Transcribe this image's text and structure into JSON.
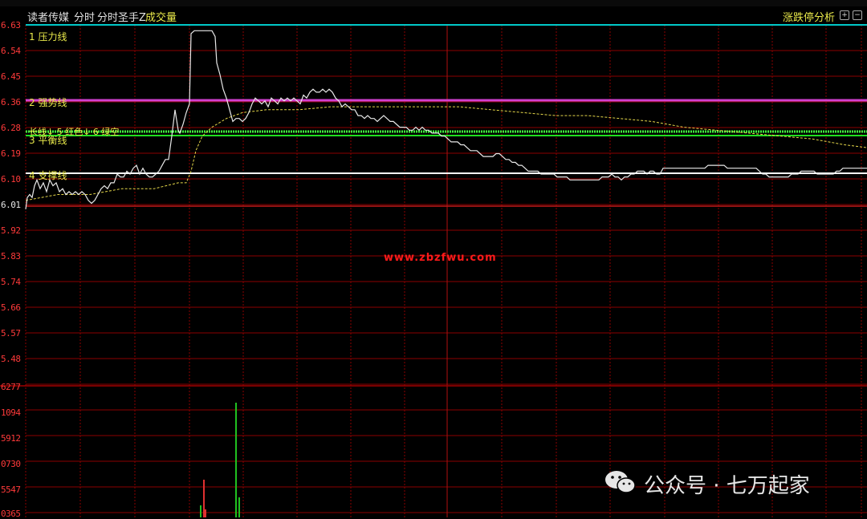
{
  "header": {
    "stock_name": "读者传媒",
    "tab_minute": "分时",
    "indicator_name": "分时圣手Z",
    "volume_label": "成交量",
    "right_panel_label": "涨跌停分析"
  },
  "price_axis": {
    "ticks": [
      "6.63",
      "6.54",
      "6.45",
      "6.36",
      "6.28",
      "6.19",
      "6.10",
      "6.01",
      "5.92",
      "5.83",
      "5.74",
      "5.66",
      "5.57",
      "5.48"
    ]
  },
  "volume_axis": {
    "ticks": [
      "6277",
      "1094",
      "5912",
      "0730",
      "5547",
      "0365"
    ]
  },
  "levels": {
    "pressure": "1 压力线",
    "strong": "2 强势线",
    "balance": "3 平衡线",
    "support": "4 支撑线",
    "signal": "长线↓ 5 红色↓ 6 绿空"
  },
  "watermark": "www.zbzfwu.com",
  "wechat": "公众号 · 七万起家",
  "colors": {
    "background": "#000000",
    "grid": "#8b0000",
    "pressure_line": "#00c8c8",
    "strong_line": "#d040d0",
    "balance_line": "#20e020",
    "support_line": "#ffffff",
    "price_line": "#e8e8e8",
    "avg_line": "#e6d84a",
    "label_yellow": "#e8e84a"
  },
  "chart_data": {
    "type": "line",
    "title": "读者传媒 分时",
    "ylim": [
      5.44,
      6.63
    ],
    "levels": {
      "pressure": 6.63,
      "strong": 6.37,
      "balance": 6.16,
      "support": 6.11
    },
    "price": [
      [
        0,
        6.0
      ],
      [
        2,
        6.04
      ],
      [
        5,
        6.05
      ],
      [
        8,
        6.04
      ],
      [
        11,
        6.08
      ],
      [
        14,
        6.1
      ],
      [
        18,
        6.07
      ],
      [
        22,
        6.09
      ],
      [
        26,
        6.06
      ],
      [
        30,
        6.1
      ],
      [
        34,
        6.08
      ],
      [
        38,
        6.09
      ],
      [
        42,
        6.06
      ],
      [
        46,
        6.07
      ],
      [
        50,
        6.05
      ],
      [
        54,
        6.06
      ],
      [
        58,
        6.05
      ],
      [
        62,
        6.06
      ],
      [
        66,
        6.05
      ],
      [
        70,
        6.06
      ],
      [
        74,
        6.05
      ],
      [
        78,
        6.03
      ],
      [
        82,
        6.02
      ],
      [
        86,
        6.03
      ],
      [
        90,
        6.05
      ],
      [
        94,
        6.07
      ],
      [
        98,
        6.08
      ],
      [
        102,
        6.07
      ],
      [
        106,
        6.09
      ],
      [
        110,
        6.09
      ],
      [
        114,
        6.12
      ],
      [
        118,
        6.11
      ],
      [
        122,
        6.11
      ],
      [
        126,
        6.13
      ],
      [
        130,
        6.12
      ],
      [
        134,
        6.14
      ],
      [
        138,
        6.15
      ],
      [
        142,
        6.12
      ],
      [
        146,
        6.14
      ],
      [
        150,
        6.12
      ],
      [
        154,
        6.11
      ],
      [
        158,
        6.11
      ],
      [
        162,
        6.12
      ],
      [
        166,
        6.13
      ],
      [
        170,
        6.15
      ],
      [
        174,
        6.17
      ],
      [
        178,
        6.17
      ],
      [
        182,
        6.25
      ],
      [
        186,
        6.34
      ],
      [
        190,
        6.27
      ],
      [
        192,
        6.26
      ],
      [
        196,
        6.29
      ],
      [
        200,
        6.33
      ],
      [
        204,
        6.36
      ],
      [
        206,
        6.6
      ],
      [
        210,
        6.61
      ],
      [
        216,
        6.61
      ],
      [
        222,
        6.61
      ],
      [
        228,
        6.61
      ],
      [
        232,
        6.61
      ],
      [
        236,
        6.59
      ],
      [
        238,
        6.5
      ],
      [
        242,
        6.46
      ],
      [
        246,
        6.41
      ],
      [
        250,
        6.38
      ],
      [
        254,
        6.34
      ],
      [
        258,
        6.3
      ],
      [
        262,
        6.31
      ],
      [
        266,
        6.31
      ],
      [
        270,
        6.3
      ],
      [
        274,
        6.31
      ],
      [
        278,
        6.33
      ],
      [
        282,
        6.36
      ],
      [
        286,
        6.38
      ],
      [
        290,
        6.37
      ],
      [
        294,
        6.36
      ],
      [
        298,
        6.37
      ],
      [
        302,
        6.35
      ],
      [
        306,
        6.38
      ],
      [
        310,
        6.37
      ],
      [
        314,
        6.36
      ],
      [
        318,
        6.38
      ],
      [
        322,
        6.37
      ],
      [
        326,
        6.38
      ],
      [
        330,
        6.37
      ],
      [
        334,
        6.38
      ],
      [
        338,
        6.37
      ],
      [
        342,
        6.36
      ],
      [
        346,
        6.39
      ],
      [
        350,
        6.38
      ],
      [
        354,
        6.4
      ],
      [
        358,
        6.41
      ],
      [
        362,
        6.4
      ],
      [
        366,
        6.4
      ],
      [
        370,
        6.41
      ],
      [
        374,
        6.4
      ],
      [
        378,
        6.41
      ],
      [
        382,
        6.4
      ],
      [
        386,
        6.38
      ],
      [
        390,
        6.37
      ],
      [
        394,
        6.35
      ],
      [
        398,
        6.36
      ],
      [
        402,
        6.35
      ],
      [
        406,
        6.34
      ],
      [
        410,
        6.34
      ],
      [
        414,
        6.32
      ],
      [
        418,
        6.32
      ],
      [
        422,
        6.31
      ],
      [
        426,
        6.32
      ],
      [
        430,
        6.31
      ],
      [
        434,
        6.31
      ],
      [
        438,
        6.3
      ],
      [
        442,
        6.31
      ],
      [
        446,
        6.32
      ],
      [
        450,
        6.31
      ],
      [
        454,
        6.3
      ],
      [
        458,
        6.3
      ],
      [
        462,
        6.29
      ],
      [
        466,
        6.28
      ],
      [
        470,
        6.28
      ],
      [
        474,
        6.28
      ],
      [
        478,
        6.27
      ],
      [
        482,
        6.27
      ],
      [
        486,
        6.28
      ],
      [
        490,
        6.27
      ],
      [
        494,
        6.28
      ],
      [
        498,
        6.27
      ],
      [
        502,
        6.27
      ],
      [
        506,
        6.26
      ],
      [
        510,
        6.26
      ],
      [
        514,
        6.26
      ],
      [
        518,
        6.25
      ],
      [
        522,
        6.25
      ],
      [
        526,
        6.24
      ],
      [
        530,
        6.23
      ],
      [
        534,
        6.23
      ],
      [
        538,
        6.23
      ],
      [
        542,
        6.22
      ],
      [
        546,
        6.22
      ],
      [
        550,
        6.21
      ],
      [
        554,
        6.2
      ],
      [
        558,
        6.2
      ],
      [
        562,
        6.2
      ],
      [
        566,
        6.19
      ],
      [
        570,
        6.18
      ],
      [
        574,
        6.18
      ],
      [
        578,
        6.18
      ],
      [
        582,
        6.18
      ],
      [
        586,
        6.19
      ],
      [
        590,
        6.19
      ],
      [
        594,
        6.18
      ],
      [
        598,
        6.17
      ],
      [
        602,
        6.17
      ],
      [
        606,
        6.16
      ],
      [
        610,
        6.16
      ],
      [
        614,
        6.15
      ],
      [
        618,
        6.15
      ],
      [
        622,
        6.14
      ],
      [
        626,
        6.13
      ],
      [
        630,
        6.13
      ],
      [
        634,
        6.13
      ],
      [
        638,
        6.13
      ],
      [
        642,
        6.12
      ],
      [
        646,
        6.12
      ],
      [
        650,
        6.12
      ],
      [
        654,
        6.12
      ],
      [
        658,
        6.12
      ],
      [
        662,
        6.11
      ],
      [
        666,
        6.11
      ],
      [
        670,
        6.11
      ],
      [
        674,
        6.11
      ],
      [
        678,
        6.1
      ],
      [
        682,
        6.1
      ],
      [
        686,
        6.1
      ],
      [
        690,
        6.1
      ],
      [
        694,
        6.1
      ],
      [
        698,
        6.1
      ],
      [
        702,
        6.1
      ],
      [
        706,
        6.1
      ],
      [
        710,
        6.1
      ],
      [
        714,
        6.1
      ],
      [
        718,
        6.11
      ],
      [
        722,
        6.11
      ],
      [
        726,
        6.11
      ],
      [
        730,
        6.12
      ],
      [
        734,
        6.11
      ],
      [
        738,
        6.11
      ],
      [
        742,
        6.1
      ],
      [
        746,
        6.11
      ],
      [
        750,
        6.11
      ],
      [
        754,
        6.12
      ],
      [
        758,
        6.12
      ],
      [
        762,
        6.13
      ],
      [
        766,
        6.13
      ],
      [
        770,
        6.13
      ],
      [
        774,
        6.12
      ],
      [
        778,
        6.13
      ],
      [
        782,
        6.13
      ],
      [
        786,
        6.12
      ],
      [
        790,
        6.12
      ],
      [
        794,
        6.14
      ],
      [
        798,
        6.14
      ],
      [
        802,
        6.14
      ],
      [
        806,
        6.14
      ],
      [
        810,
        6.14
      ],
      [
        814,
        6.14
      ],
      [
        818,
        6.14
      ],
      [
        822,
        6.14
      ],
      [
        826,
        6.14
      ],
      [
        830,
        6.14
      ],
      [
        834,
        6.14
      ],
      [
        838,
        6.14
      ],
      [
        842,
        6.14
      ],
      [
        846,
        6.14
      ],
      [
        850,
        6.15
      ],
      [
        854,
        6.15
      ],
      [
        858,
        6.15
      ],
      [
        862,
        6.15
      ],
      [
        866,
        6.15
      ],
      [
        870,
        6.15
      ],
      [
        874,
        6.14
      ],
      [
        878,
        6.14
      ],
      [
        882,
        6.14
      ],
      [
        886,
        6.14
      ],
      [
        890,
        6.14
      ],
      [
        894,
        6.14
      ],
      [
        898,
        6.14
      ],
      [
        902,
        6.14
      ],
      [
        906,
        6.14
      ],
      [
        910,
        6.14
      ],
      [
        914,
        6.13
      ],
      [
        918,
        6.12
      ],
      [
        922,
        6.12
      ],
      [
        926,
        6.11
      ],
      [
        930,
        6.11
      ],
      [
        934,
        6.11
      ],
      [
        938,
        6.11
      ],
      [
        942,
        6.11
      ],
      [
        946,
        6.11
      ],
      [
        950,
        6.11
      ],
      [
        954,
        6.12
      ],
      [
        958,
        6.12
      ],
      [
        962,
        6.12
      ],
      [
        966,
        6.13
      ],
      [
        970,
        6.13
      ],
      [
        974,
        6.13
      ],
      [
        978,
        6.13
      ],
      [
        982,
        6.13
      ],
      [
        986,
        6.12
      ],
      [
        990,
        6.12
      ],
      [
        994,
        6.12
      ],
      [
        998,
        6.12
      ],
      [
        1002,
        6.12
      ],
      [
        1006,
        6.12
      ],
      [
        1010,
        6.13
      ],
      [
        1014,
        6.13
      ],
      [
        1018,
        6.14
      ],
      [
        1022,
        6.14
      ],
      [
        1026,
        6.14
      ],
      [
        1030,
        6.14
      ],
      [
        1034,
        6.14
      ],
      [
        1038,
        6.14
      ],
      [
        1042,
        6.14
      ],
      [
        1046,
        6.14
      ],
      [
        1049,
        6.14
      ]
    ],
    "avg": [
      [
        0,
        6.03
      ],
      [
        40,
        6.05
      ],
      [
        80,
        6.05
      ],
      [
        120,
        6.07
      ],
      [
        160,
        6.07
      ],
      [
        190,
        6.09
      ],
      [
        200,
        6.09
      ],
      [
        206,
        6.13
      ],
      [
        212,
        6.2
      ],
      [
        220,
        6.25
      ],
      [
        232,
        6.28
      ],
      [
        250,
        6.31
      ],
      [
        270,
        6.33
      ],
      [
        300,
        6.34
      ],
      [
        340,
        6.34
      ],
      [
        380,
        6.35
      ],
      [
        420,
        6.35
      ],
      [
        460,
        6.35
      ],
      [
        500,
        6.35
      ],
      [
        540,
        6.35
      ],
      [
        580,
        6.34
      ],
      [
        620,
        6.33
      ],
      [
        660,
        6.32
      ],
      [
        700,
        6.32
      ],
      [
        740,
        6.31
      ],
      [
        780,
        6.3
      ],
      [
        820,
        6.28
      ],
      [
        860,
        6.27
      ],
      [
        900,
        6.26
      ],
      [
        940,
        6.25
      ],
      [
        980,
        6.24
      ],
      [
        1020,
        6.22
      ],
      [
        1049,
        6.21
      ]
    ]
  }
}
